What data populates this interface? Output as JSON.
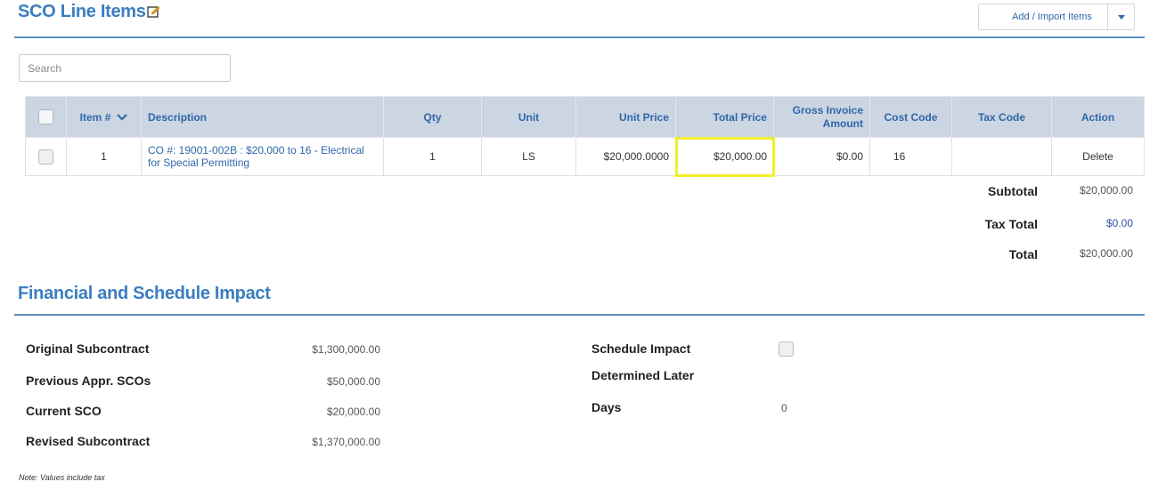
{
  "header": {
    "title": "SCO Line Items",
    "add_import_label": "Add / Import Items"
  },
  "search": {
    "placeholder": "Search",
    "value": ""
  },
  "table": {
    "columns": {
      "item": "Item #",
      "description": "Description",
      "qty": "Qty",
      "unit": "Unit",
      "unit_price": "Unit Price",
      "total_price": "Total Price",
      "gross_line1": "Gross Invoice",
      "gross_line2": "Amount",
      "cost_code": "Cost Code",
      "tax_code": "Tax Code",
      "action": "Action"
    },
    "rows": [
      {
        "item": "1",
        "description": "CO #: 19001-002B : $20,000 to 16 - Electrical for Special Permitting",
        "qty": "1",
        "unit": "LS",
        "unit_price": "$20,000.0000",
        "total_price": "$20,000.00",
        "gross_invoice_amount": "$0.00",
        "cost_code": "16",
        "tax_code": "",
        "action": "Delete"
      }
    ]
  },
  "totals": {
    "subtotal_label": "Subtotal",
    "subtotal": "$20,000.00",
    "tax_total_label": "Tax Total",
    "tax_total": "$0.00",
    "total_label": "Total",
    "total": "$20,000.00"
  },
  "impact": {
    "title": "Financial and Schedule Impact",
    "original_label": "Original Subcontract",
    "original": "$1,300,000.00",
    "previous_label": "Previous Appr. SCOs",
    "previous": "$50,000.00",
    "current_label": "Current SCO",
    "current": "$20,000.00",
    "revised_label": "Revised Subcontract",
    "revised": "$1,370,000.00",
    "schedule_impact_label": "Schedule Impact",
    "determined_later_label": "Determined Later",
    "days_label": "Days",
    "days": "0"
  },
  "note": "Note: Values include tax",
  "colors": {
    "accent": "#3b7ec0",
    "header_bg": "#ccd5e2",
    "delete": "#e0443a",
    "highlight": "#f2ee2b"
  }
}
